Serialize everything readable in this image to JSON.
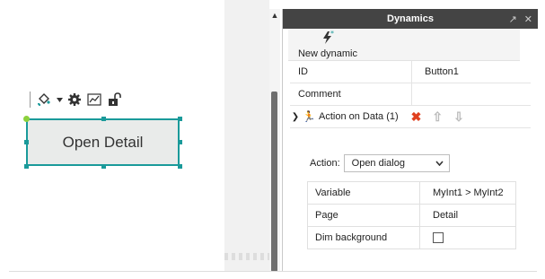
{
  "designer": {
    "widget": {
      "label": "Open Detail"
    },
    "toolbar": {
      "icons": [
        "paint-bucket-icon",
        "caret-down-icon",
        "gear-icon",
        "chart-icon",
        "unlock-icon"
      ]
    }
  },
  "panel": {
    "title": "Dynamics",
    "new_dynamic_label": "New dynamic",
    "props": [
      {
        "key": "ID",
        "value": "Button1"
      },
      {
        "key": "Comment",
        "value": ""
      }
    ],
    "action_item": {
      "label": "Action on Data (1)"
    },
    "action_field": {
      "label": "Action:",
      "selected": "Open dialog"
    },
    "inner": [
      {
        "key": "Variable",
        "value": "MyInt1 > MyInt2"
      },
      {
        "key": "Page",
        "value": "Detail"
      },
      {
        "key": "Dim background",
        "checked": false
      }
    ]
  },
  "colors": {
    "accent": "#1a9a9a",
    "header_bg": "#444444",
    "delete": "#e0401f"
  }
}
